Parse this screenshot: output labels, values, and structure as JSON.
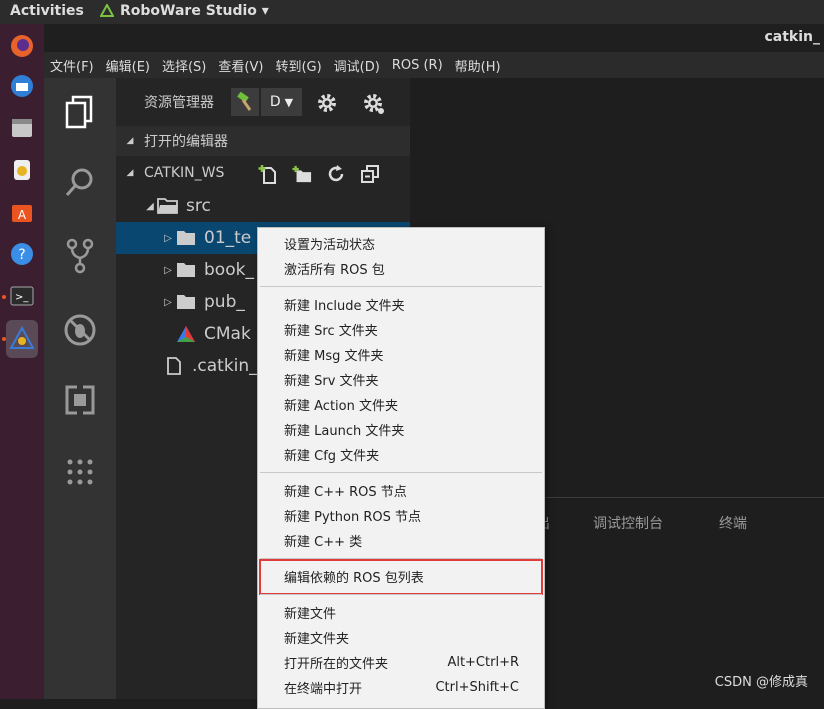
{
  "topbar": {
    "activities": "Activities",
    "app_name": "RoboWare Studio ▾"
  },
  "window": {
    "title": "catkin_"
  },
  "menubar": [
    "文件(F)",
    "编辑(E)",
    "选择(S)",
    "查看(V)",
    "转到(G)",
    "调试(D)",
    "ROS (R)",
    "帮助(H)"
  ],
  "dock": {
    "icons": [
      "firefox-icon",
      "thunderbird-icon",
      "files-icon",
      "rhythmbox-icon",
      "software-center-icon",
      "help-icon",
      "terminal-icon",
      "roboware-icon"
    ]
  },
  "activitybar": {
    "icons": [
      "explorer-icon",
      "search-icon",
      "source-control-icon",
      "debug-icon",
      "extensions-icon",
      "apps-grid-icon"
    ]
  },
  "sidebar": {
    "title": "资源管理器",
    "combo_value": "D",
    "open_editors": "打开的编辑器",
    "workspace": "CATKIN_WS",
    "tree": [
      {
        "label": "src",
        "icon": "folder-open-icon",
        "twisty": "◢"
      },
      {
        "label": "01_te",
        "icon": "folder-icon",
        "twisty": "▷"
      },
      {
        "label": "book_",
        "icon": "folder-icon",
        "twisty": "▷"
      },
      {
        "label": "pub_",
        "icon": "folder-icon",
        "twisty": "▷"
      },
      {
        "label": "CMak",
        "icon": "cmake-icon",
        "twisty": ""
      },
      {
        "label": ".catkin_",
        "icon": "file-icon",
        "twisty": ""
      }
    ]
  },
  "panel": {
    "tab_partial": "出",
    "tab_debug_console": "调试控制台",
    "tab_terminal": "终端",
    "credit": "CSDN @修成真"
  },
  "context_menu": {
    "items": [
      {
        "label": "设置为活动状态",
        "shortcut": ""
      },
      {
        "label": "激活所有 ROS 包",
        "shortcut": ""
      },
      {
        "label": "新建 Include 文件夹",
        "shortcut": ""
      },
      {
        "label": "新建 Src 文件夹",
        "shortcut": ""
      },
      {
        "label": "新建 Msg 文件夹",
        "shortcut": ""
      },
      {
        "label": "新建 Srv 文件夹",
        "shortcut": ""
      },
      {
        "label": "新建 Action 文件夹",
        "shortcut": ""
      },
      {
        "label": "新建 Launch 文件夹",
        "shortcut": ""
      },
      {
        "label": "新建 Cfg 文件夹",
        "shortcut": ""
      },
      {
        "label": "新建 C++ ROS 节点",
        "shortcut": ""
      },
      {
        "label": "新建 Python ROS 节点",
        "shortcut": ""
      },
      {
        "label": "新建 C++ 类",
        "shortcut": ""
      },
      {
        "label": "编辑依赖的 ROS 包列表",
        "shortcut": ""
      },
      {
        "label": "新建文件",
        "shortcut": ""
      },
      {
        "label": "新建文件夹",
        "shortcut": ""
      },
      {
        "label": "打开所在的文件夹",
        "shortcut": "Alt+Ctrl+R"
      },
      {
        "label": "在终端中打开",
        "shortcut": "Ctrl+Shift+C"
      }
    ]
  },
  "colors": {
    "selection": "#094771",
    "highlight_box": "#e03c3c",
    "dock_bg": "#3b1f30"
  }
}
